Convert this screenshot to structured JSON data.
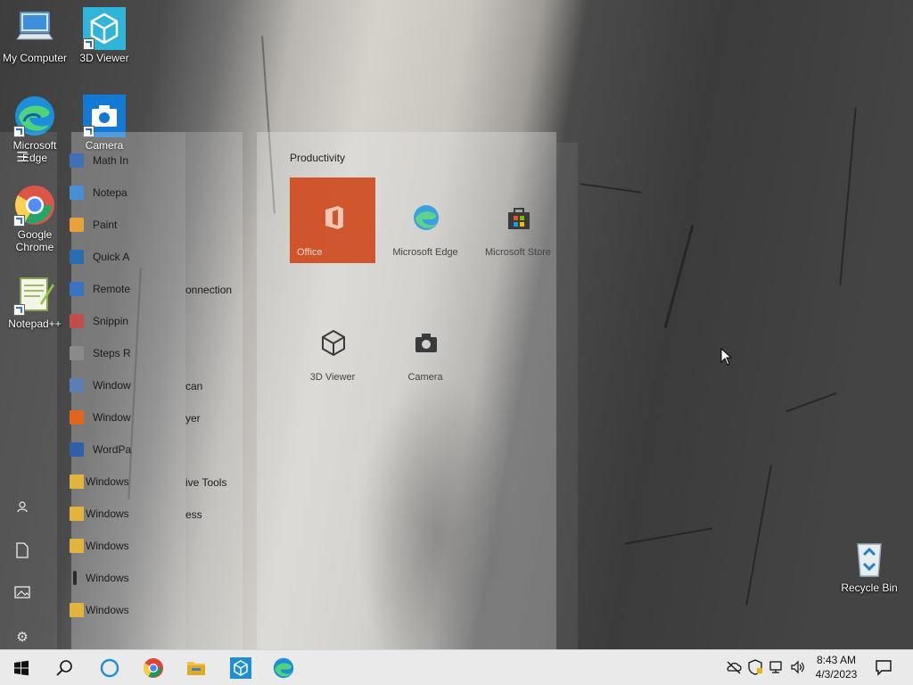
{
  "desktop": {
    "icons": [
      {
        "id": "my-computer",
        "label": "My Computer"
      },
      {
        "id": "3d-viewer",
        "label": "3D Viewer"
      },
      {
        "id": "microsoft-edge",
        "label": "Microsoft Edge"
      },
      {
        "id": "camera",
        "label": "Camera"
      },
      {
        "id": "google-chrome",
        "label": "Google Chrome"
      },
      {
        "id": "notepad-plus-plus",
        "label": "Notepad++"
      },
      {
        "id": "recycle-bin",
        "label": "Recycle Bin"
      }
    ]
  },
  "start_menu": {
    "apps": [
      {
        "label": "Math In",
        "icon": "math-input-icon",
        "color": "#3f6fb5"
      },
      {
        "label": "Notepa",
        "icon": "notepad-icon",
        "color": "#4a8fd6"
      },
      {
        "label": "Paint",
        "icon": "paint-icon",
        "color": "#e9a23b"
      },
      {
        "label": "Quick A",
        "icon": "quick-assist-icon",
        "color": "#2b6cb0"
      },
      {
        "label": "Remote",
        "icon": "remote-desktop-icon",
        "color": "#3774c4"
      },
      {
        "label": "Snippin",
        "icon": "snipping-tool-icon",
        "color": "#c24b4b"
      },
      {
        "label": "Steps R",
        "icon": "steps-recorder-icon",
        "color": "#8a8a8a"
      },
      {
        "label": "Window",
        "icon": "windows-fax-icon",
        "color": "#5a7fb0"
      },
      {
        "label": "Window",
        "icon": "windows-media-player-icon",
        "color": "#e0651f"
      },
      {
        "label": "WordPa",
        "icon": "wordpad-icon",
        "color": "#2f5fa6"
      }
    ],
    "folders": [
      {
        "label": "Windows"
      },
      {
        "label": "Windows"
      },
      {
        "label": "Windows"
      },
      {
        "label": "Windows",
        "dark": true
      },
      {
        "label": "Windows"
      }
    ],
    "overflow_text": [
      {
        "text": "onnection"
      },
      {
        "text": "can"
      },
      {
        "text": "yer"
      },
      {
        "text": "ive Tools"
      },
      {
        "text": "ess"
      }
    ],
    "tile_group": "Productivity",
    "tiles": [
      {
        "label": "Office",
        "icon": "office-icon"
      },
      {
        "label": "Microsoft Edge",
        "icon": "edge-icon"
      },
      {
        "label": "Microsoft Store",
        "icon": "store-icon"
      },
      {
        "label": "3D Viewer",
        "icon": "cube-icon"
      },
      {
        "label": "Camera",
        "icon": "camera-icon"
      }
    ]
  },
  "taskbar": {
    "pinned": [
      "start",
      "search",
      "cortana",
      "chrome",
      "file-explorer",
      "3d-viewer",
      "edge"
    ],
    "clock": {
      "time": "8:43 AM",
      "date": "4/3/2023"
    }
  },
  "colors": {
    "office_tile": "#d04b1f",
    "taskbar": "#eaeaea",
    "accent_blue": "#0078d7"
  }
}
